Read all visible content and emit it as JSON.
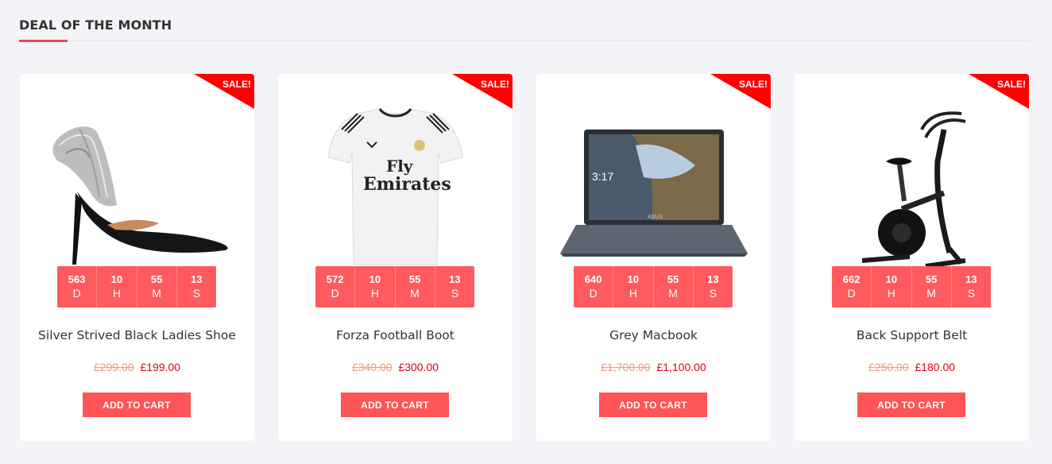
{
  "section": {
    "title": "DEAL OF THE MONTH"
  },
  "products": [
    {
      "badge": "SALE!",
      "image_icon": "high-heel-shoe-image",
      "countdown": [
        {
          "value": "563",
          "unit": "D"
        },
        {
          "value": "10",
          "unit": "H"
        },
        {
          "value": "55",
          "unit": "M"
        },
        {
          "value": "13",
          "unit": "S"
        }
      ],
      "name": "Silver Strived Black Ladies Shoe",
      "old_price": "£299.00",
      "new_price": "£199.00",
      "button": "ADD TO CART"
    },
    {
      "badge": "SALE!",
      "image_icon": "football-jersey-image",
      "jersey_text_1": "Fly",
      "jersey_text_2": "Emirates",
      "countdown": [
        {
          "value": "572",
          "unit": "D"
        },
        {
          "value": "10",
          "unit": "H"
        },
        {
          "value": "55",
          "unit": "M"
        },
        {
          "value": "13",
          "unit": "S"
        }
      ],
      "name": "Forza Football Boot",
      "old_price": "£340.00",
      "new_price": "£300.00",
      "button": "ADD TO CART"
    },
    {
      "badge": "SALE!",
      "image_icon": "laptop-image",
      "laptop_time": "3:17",
      "laptop_brand": "ASUS",
      "countdown": [
        {
          "value": "640",
          "unit": "D"
        },
        {
          "value": "10",
          "unit": "H"
        },
        {
          "value": "55",
          "unit": "M"
        },
        {
          "value": "13",
          "unit": "S"
        }
      ],
      "name": "Grey Macbook",
      "old_price": "£1,700.00",
      "new_price": "£1,100.00",
      "button": "ADD TO CART"
    },
    {
      "badge": "SALE!",
      "image_icon": "exercise-bike-image",
      "countdown": [
        {
          "value": "662",
          "unit": "D"
        },
        {
          "value": "10",
          "unit": "H"
        },
        {
          "value": "55",
          "unit": "M"
        },
        {
          "value": "13",
          "unit": "S"
        }
      ],
      "name": "Back Support Belt",
      "old_price": "£250.00",
      "new_price": "£180.00",
      "button": "ADD TO CART"
    }
  ],
  "colors": {
    "accent": "#ff5a5f",
    "sale_badge": "#ff0000",
    "new_price": "#e0001a",
    "old_price": "#f09a7d",
    "background": "#f3f4f7"
  }
}
